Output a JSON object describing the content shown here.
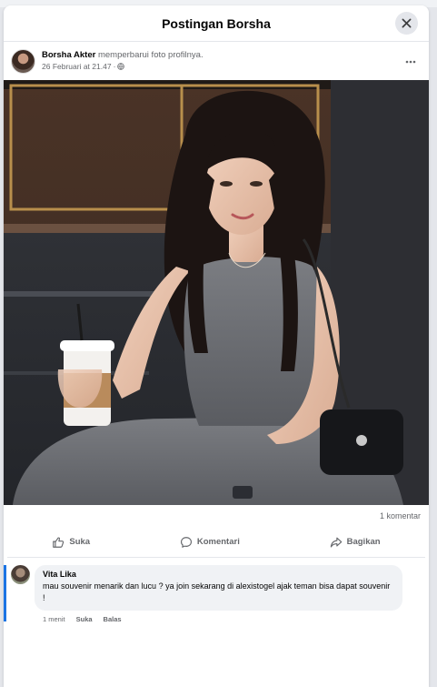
{
  "modal": {
    "title": "Postingan Borsha"
  },
  "post": {
    "author": "Borsha Akter",
    "action": "memperbarui foto profilnya.",
    "date": "26 Februari at 21.47",
    "separator": "·",
    "audience_icon": "globe-icon",
    "more_icon": "more-options-icon"
  },
  "stats": {
    "comments": "1 komentar"
  },
  "actions": {
    "like": "Suka",
    "comment": "Komentari",
    "share": "Bagikan"
  },
  "comments": [
    {
      "name": "Vita Lika",
      "text": "mau souvenir menarik dan lucu ? ya join sekarang di alexistogel ajak teman bisa dapat souvenir !",
      "time": "1 menit",
      "like": "Suka",
      "reply": "Balas"
    }
  ],
  "colors": {
    "accent": "#1b74e4",
    "secondary_text": "#65676b",
    "bubble": "#f0f2f5"
  }
}
